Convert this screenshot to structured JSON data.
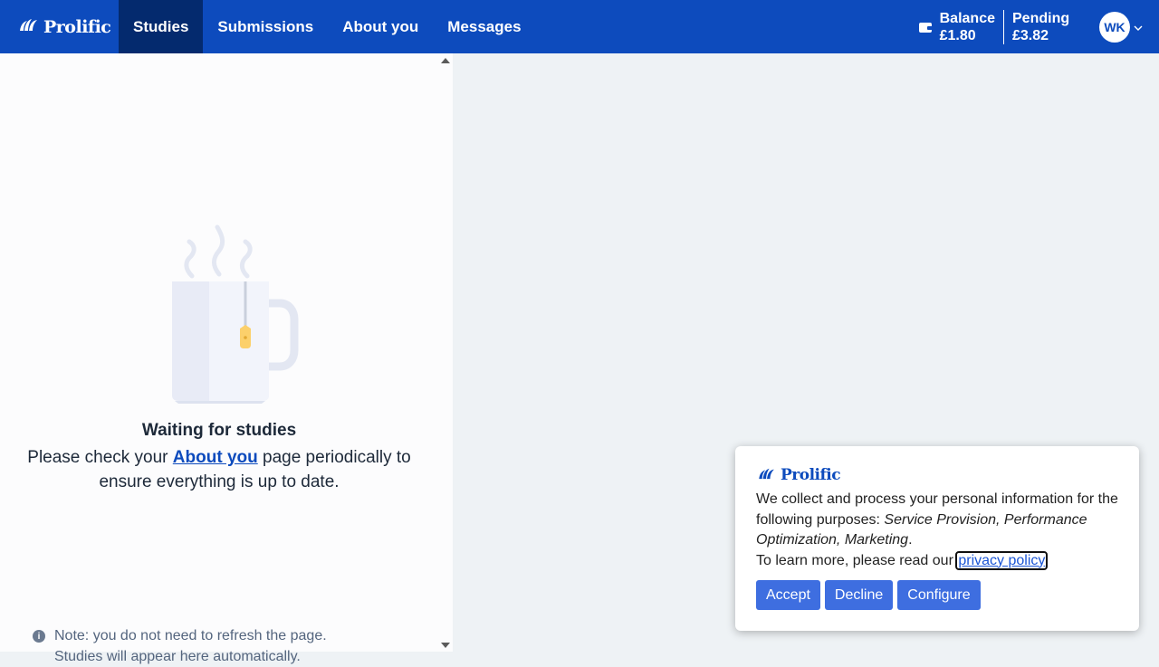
{
  "brand": {
    "name": "Prolific"
  },
  "nav": {
    "items": [
      {
        "label": "Studies",
        "active": true
      },
      {
        "label": "Submissions",
        "active": false
      },
      {
        "label": "About you",
        "active": false
      },
      {
        "label": "Messages",
        "active": false
      }
    ]
  },
  "account": {
    "balance_label": "Balance",
    "balance_value": "£1.80",
    "pending_label": "Pending",
    "pending_value": "£3.82",
    "avatar_initials": "WK"
  },
  "empty_state": {
    "title": "Waiting for studies",
    "desc_before": "Please check your ",
    "desc_link": "About you",
    "desc_after": " page periodically to ensure everything is up to date."
  },
  "note": {
    "icon": "info-icon",
    "line1": "Note: you do not need to refresh the page.",
    "line2": "Studies will appear here automatically."
  },
  "cookie_banner": {
    "brand": "Prolific",
    "text_intro": "We collect and process your personal information for the following purposes: ",
    "purposes": "Service Provision, Performance Optimization, Marketing",
    "text_period": ".",
    "learn_more": "To learn more, please read our ",
    "privacy_link": "privacy policy",
    "buttons": {
      "accept": "Accept",
      "decline": "Decline",
      "configure": "Configure"
    }
  },
  "colors": {
    "nav_bg": "#0d4bbd",
    "nav_active_bg": "#042a6e",
    "button_bg": "#3e6ee0",
    "link": "#0d4bbd"
  }
}
